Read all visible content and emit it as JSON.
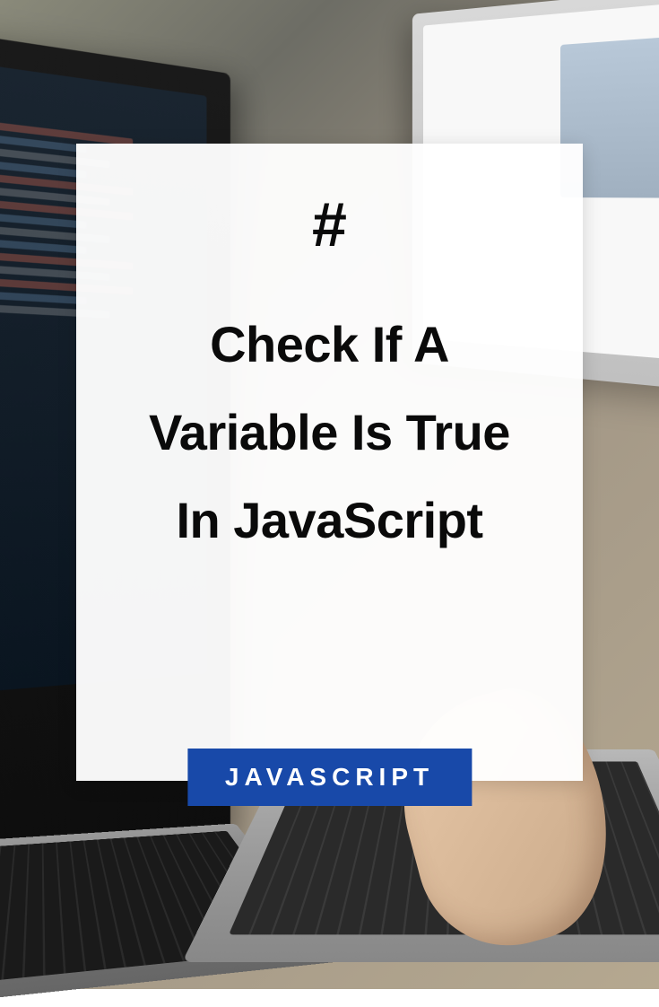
{
  "card": {
    "hash": "#",
    "title": "Check If A Variable Is True In JavaScript",
    "badge": "JAVASCRIPT"
  },
  "colors": {
    "badge_bg": "#1849a9",
    "badge_text": "#ffffff",
    "title_text": "#0a0a0a"
  }
}
